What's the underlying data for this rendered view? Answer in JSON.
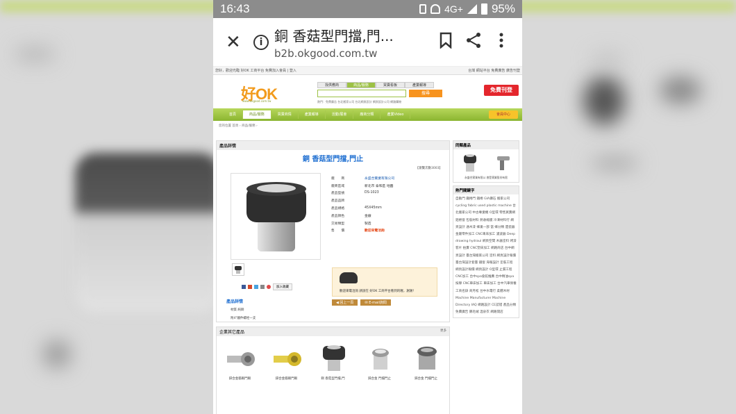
{
  "status_bar": {
    "time": "16:43",
    "network": "4G+",
    "battery": "95%"
  },
  "browser": {
    "title": "銅 香菇型門擋,門...",
    "url": "b2b.okgood.com.tw"
  },
  "site": {
    "top_left": "您好，歡迎光臨 好OK 工商平台 免費加入會員 | 登入",
    "top_right": "台灣    網站平台 免費廣告    廣告刊登",
    "logo_text": "好OK",
    "logo_url": "www.okgood.com.tw",
    "search_tabs": [
      "找供應商",
      "商品/服務",
      "買賣看板",
      "產業報導"
    ],
    "search_button": "搜尋",
    "hot_label": "熱門：",
    "hot_terms": "免費廣告 台北搬家公司 台北網頁設計 網頁設計公司 網路購物",
    "free_button": "免費刊登",
    "nav": [
      "首頁",
      "商品/服務",
      "買賣商情",
      "產業報導",
      "活動/展會",
      "廠商分類",
      "產業Video"
    ],
    "nav_member": "會員中心",
    "breadcrumb": "您的位置 首頁 › 商品/服務 ›"
  },
  "product": {
    "panel_title": "產品詳情",
    "title": "銅 香菇型門擋,門止",
    "views": "【瀏覽次數3003】",
    "specs": [
      {
        "k": "廠　　商",
        "v": "永盛合實業有限公司"
      },
      {
        "k": "廠商區域",
        "v": "新北市 泰和區 地圖"
      },
      {
        "k": "產品型號",
        "v": "DS-1023"
      },
      {
        "k": "產品品牌",
        "v": ""
      },
      {
        "k": "產品規格",
        "v": "45X45mm"
      },
      {
        "k": "產品顏色",
        "v": "金銀"
      },
      {
        "k": "交易類型",
        "v": "製造"
      },
      {
        "k": "售　　價",
        "v": "歡迎來電洽詢"
      }
    ],
    "contact_text": "歡迎來電洽詢 請說在 好OK 工商平台看到的喔，謝謝！",
    "btn_back": "◀ 回上一頁",
    "btn_email": "✉ E-mail詢問",
    "fav": "加入收藏",
    "detail_title": "產品詳情",
    "detail_lines": [
      "材質 純銅",
      "附4\"牆件螺栓一支"
    ]
  },
  "other_products": {
    "title": "企業其它產品",
    "more": "更多",
    "items": [
      {
        "name": "鋅合金貓眼門眼",
        "color": "#b8b8b8"
      },
      {
        "name": "鋅合金貓眼門眼",
        "color": "#d9c23a"
      },
      {
        "name": "銅 香菇型門擋,門",
        "color": "#3a3a3a"
      },
      {
        "name": "鋅合金 門擋門止",
        "color": "#c9c9c9"
      },
      {
        "name": "鋅合金 門擋門止",
        "color": "#7a7a7a"
      }
    ]
  },
  "sidebar": {
    "same_title": "同類產品",
    "same_caption": "永盛合實業有限公 睿登實業股份有限",
    "hot_title": "熱門關鍵字",
    "keywords": "自動門 鐵捲門 鐵捲 GIA鑽石 搬家公司 cycling fabric used plastic machine 台北搬家公司 中古專業機 O型環 零售買賣網 鋁捲窗 包裝材料 熱收縮膜 冷凍材料行 網頁設計 通木漆 蜂巢一部 當 蜂分類 遺瓷器 金屬零件加工 CNC車床加工 濾波器 Deep drawing hydraul 網頁空間 木器塗料 烤漆 客片 拍賣 CNC塑床加工 網路商店 台中網頁設計 臺台灣搬家公司 塗料 網頁設計報價 臺台灣設計套臺 鐵窗 海報設計 塗裝工程 網頁設計報價 網頁設計 O型環 止漏工程 CNC加工 台中spa會館推薦 台中精油spa按摩 CNC車床加工 車床加工 台中汽車保養 工商名錄 商月松 台中水電行 柔體木材 Machine Manufacturer Machine Directory IAQ 網路設計 CE認證 產品分類 免費廣告 鵝毛絨 溫泉衣 網路開店"
  },
  "colors": {
    "nav_green": "#8ab530",
    "accent_orange": "#f29b1d",
    "link_blue": "#1f6fd1",
    "free_red": "#e4262c"
  }
}
